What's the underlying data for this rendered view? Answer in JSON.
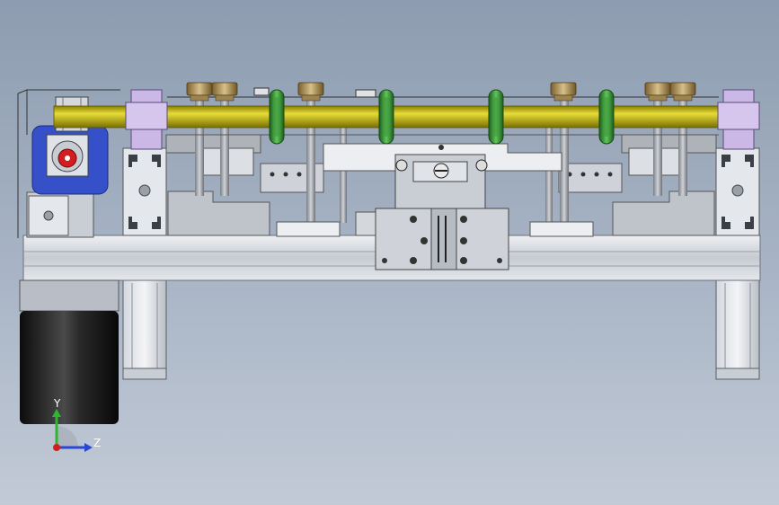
{
  "viewport": {
    "background_top": "#8d9cb0",
    "background_bottom": "#c2cad6"
  },
  "model": {
    "shaft_color": "#c8bd12",
    "o_ring_color": "#3d9a3a",
    "roller_color": "#b49a5e",
    "bearing_block_color": "#cbb8e6",
    "motor_color": "#1b1b1b",
    "aluminum_color": "#d9dde3",
    "gearbox_color": "#3550c8",
    "knob_color": "#d21e1e",
    "o_ring_count": 4,
    "roller_count": 6
  },
  "triad": {
    "y_label": "Y",
    "z_label": "Z",
    "y_color": "#2fb52f",
    "z_color": "#2a48d6",
    "x_color": "#d21e1e"
  }
}
